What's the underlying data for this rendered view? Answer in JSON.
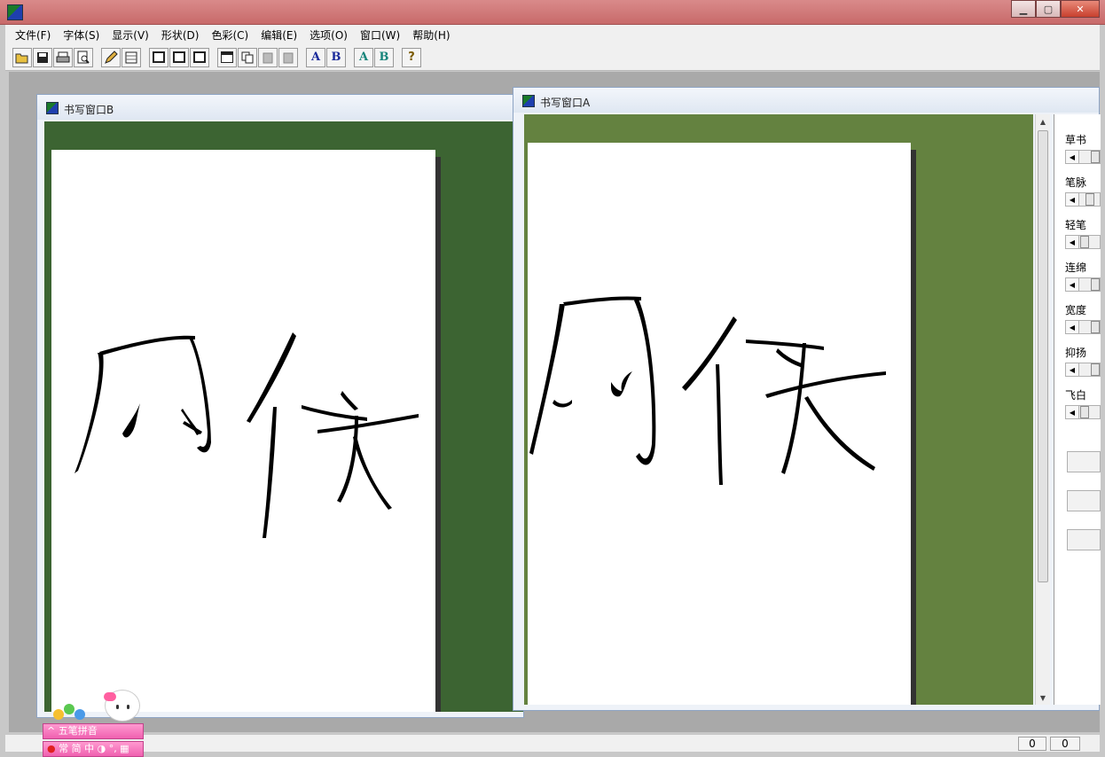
{
  "menu": {
    "items": [
      "文件(F)",
      "字体(S)",
      "显示(V)",
      "形状(D)",
      "色彩(C)",
      "编辑(E)",
      "选项(O)",
      "窗口(W)",
      "帮助(H)"
    ]
  },
  "toolbar": {
    "letters": {
      "a_blue": "A",
      "b_blue": "B",
      "a_teal": "A",
      "b_teal": "B",
      "help": "?"
    }
  },
  "window_b": {
    "title": "书写窗口B",
    "background": "#3c6432"
  },
  "window_a": {
    "title": "书写窗口A",
    "background": "#648240"
  },
  "side_panel": {
    "sliders": [
      {
        "label": "草书",
        "value": 0
      },
      {
        "label": "笔脉",
        "value": 0.4
      },
      {
        "label": "轻笔",
        "value": 0.1
      },
      {
        "label": "连绵",
        "value": 0
      },
      {
        "label": "宽度",
        "value": 0
      },
      {
        "label": "抑扬",
        "value": 0
      },
      {
        "label": "飞白",
        "value": 0.1
      }
    ]
  },
  "status": {
    "cell1": "0",
    "cell2": "0"
  },
  "ime": {
    "mode": "五笔拼音",
    "bar": "常 简 中 ◑ °, ▦"
  }
}
